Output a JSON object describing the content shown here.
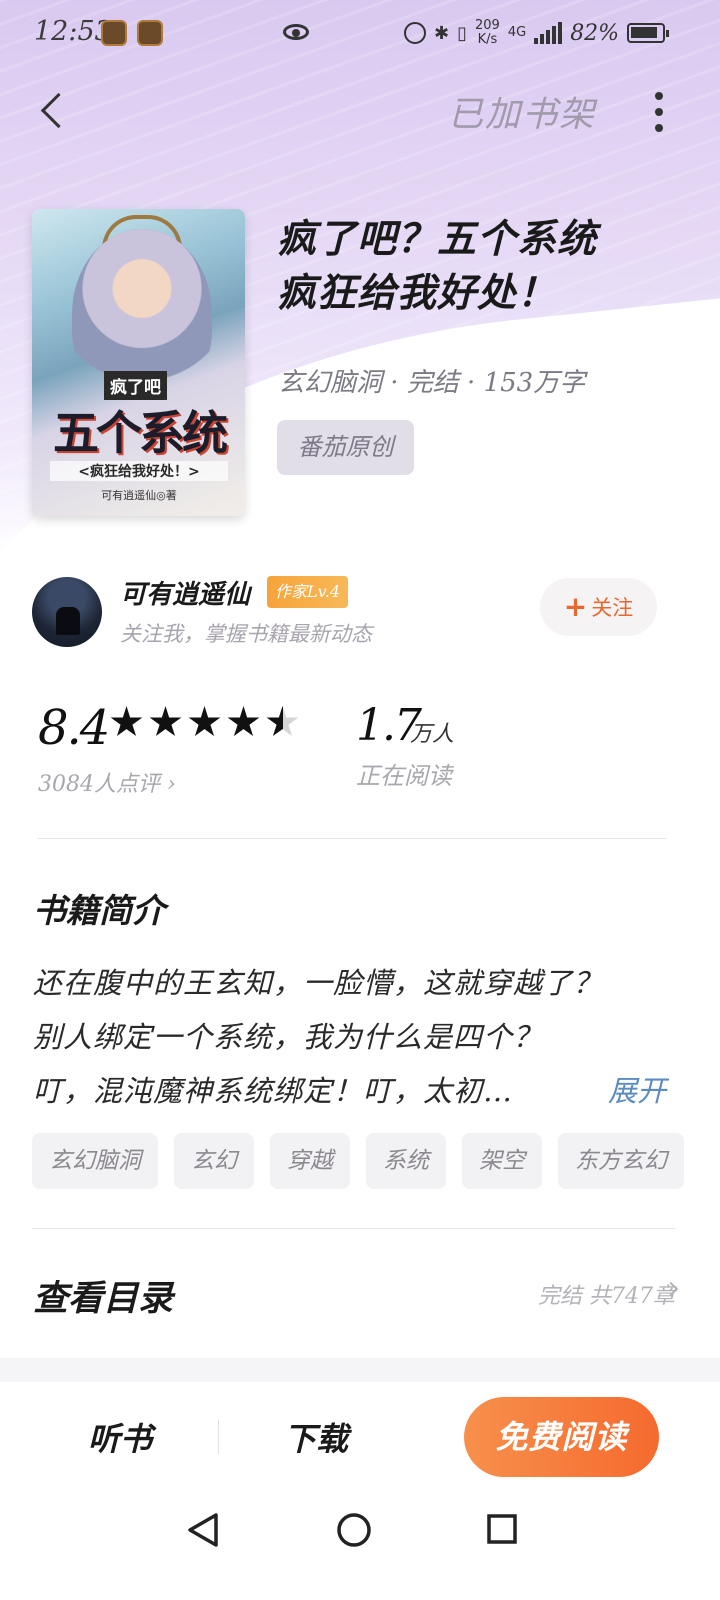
{
  "status_bar": {
    "time": "12:53",
    "speed_value": "209",
    "speed_unit": "K/s",
    "network": "4G",
    "battery": "82%"
  },
  "nav": {
    "shelf_label": "已加书架"
  },
  "book": {
    "title_line1": "疯了吧？五个系统",
    "title_line2": "疯狂给我好处！",
    "meta": "玄幻脑洞 · 完结 · 153万字",
    "publisher_tag": "番茄原创",
    "cover": {
      "small_title": "疯了吧",
      "big_title": "五个系统",
      "sub_title": "<疯狂给我好处！>",
      "author": "可有逍遥仙◎著"
    }
  },
  "author": {
    "name": "可有逍遥仙",
    "level": "作家Lv.4",
    "desc": "关注我，掌握书籍最新动态",
    "follow_label": "关注"
  },
  "rating": {
    "score": "8.4",
    "stars": 4.5,
    "review_count": "3084人点评 ›",
    "readers_num": "1.7",
    "readers_unit": "万人",
    "readers_label": "正在阅读"
  },
  "intro": {
    "heading": "书籍简介",
    "lines": [
      "还在腹中的王玄知，一脸懵，这就穿越了？",
      "别人绑定一个系统，我为什么是四个？",
      "叮，混沌魔神系统绑定！叮，太初…"
    ],
    "expand_label": "展开",
    "tags": [
      "玄幻脑洞",
      "玄幻",
      "穿越",
      "系统",
      "架空",
      "东方玄幻"
    ]
  },
  "catalog": {
    "heading": "查看目录",
    "status": "完结 共747章"
  },
  "actions": {
    "listen": "听书",
    "download": "下载",
    "read": "免费阅读"
  },
  "colors": {
    "accent": "#f56a2e",
    "link": "#5b8bc0",
    "header_bg": "#e6daf6"
  },
  "icons": {
    "back": "chevron-left-icon",
    "more": "more-vertical-icon",
    "nav_back": "triangle-back-icon",
    "nav_home": "circle-home-icon",
    "nav_recent": "square-recent-icon"
  }
}
